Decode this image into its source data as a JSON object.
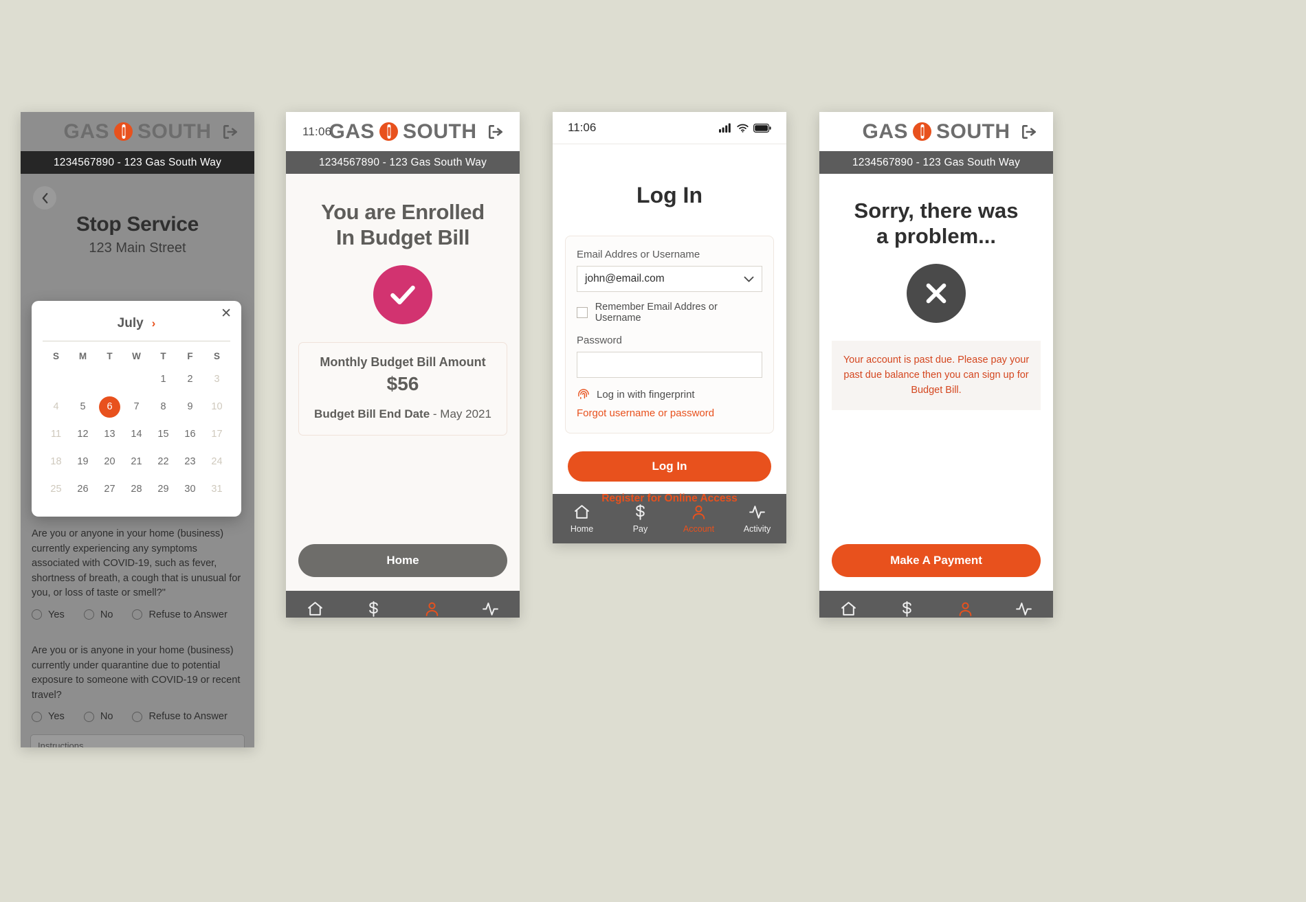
{
  "brand": {
    "name_left": "GAS",
    "name_right": "SOUTH",
    "flame_color": "#e8511d"
  },
  "account_bar": {
    "text": "1234567890 - 123 Gas South Way"
  },
  "tabs": [
    {
      "label": "Home",
      "icon": "home-icon"
    },
    {
      "label": "Pay",
      "icon": "dollar-icon"
    },
    {
      "label": "Account",
      "icon": "person-icon"
    },
    {
      "label": "Activity",
      "icon": "activity-icon"
    }
  ],
  "phone1": {
    "back_icon": "chevron-left-icon",
    "title": "Stop Service",
    "subtitle": "123 Main Street",
    "calendar": {
      "close_icon": "close-icon",
      "month": "July",
      "next_icon": "chevron-right-icon",
      "dow": [
        "S",
        "M",
        "T",
        "W",
        "T",
        "F",
        "S"
      ],
      "weeks": [
        [
          {
            "d": "",
            "state": "empty"
          },
          {
            "d": "",
            "state": "empty"
          },
          {
            "d": "",
            "state": "empty"
          },
          {
            "d": "",
            "state": "empty"
          },
          {
            "d": "1",
            "state": "normal"
          },
          {
            "d": "2",
            "state": "normal"
          },
          {
            "d": "3",
            "state": "muted"
          }
        ],
        [
          {
            "d": "4",
            "state": "muted"
          },
          {
            "d": "5",
            "state": "normal"
          },
          {
            "d": "6",
            "state": "selected"
          },
          {
            "d": "7",
            "state": "normal"
          },
          {
            "d": "8",
            "state": "normal"
          },
          {
            "d": "9",
            "state": "normal"
          },
          {
            "d": "10",
            "state": "muted"
          }
        ],
        [
          {
            "d": "11",
            "state": "muted"
          },
          {
            "d": "12",
            "state": "normal"
          },
          {
            "d": "13",
            "state": "normal"
          },
          {
            "d": "14",
            "state": "normal"
          },
          {
            "d": "15",
            "state": "normal"
          },
          {
            "d": "16",
            "state": "normal"
          },
          {
            "d": "17",
            "state": "muted"
          }
        ],
        [
          {
            "d": "18",
            "state": "muted"
          },
          {
            "d": "19",
            "state": "normal"
          },
          {
            "d": "20",
            "state": "normal"
          },
          {
            "d": "21",
            "state": "normal"
          },
          {
            "d": "22",
            "state": "normal"
          },
          {
            "d": "23",
            "state": "normal"
          },
          {
            "d": "24",
            "state": "muted"
          }
        ],
        [
          {
            "d": "25",
            "state": "muted"
          },
          {
            "d": "26",
            "state": "normal"
          },
          {
            "d": "27",
            "state": "normal"
          },
          {
            "d": "28",
            "state": "normal"
          },
          {
            "d": "29",
            "state": "normal"
          },
          {
            "d": "30",
            "state": "normal"
          },
          {
            "d": "31",
            "state": "muted"
          }
        ]
      ]
    },
    "radio_options": [
      "Yes",
      "No",
      "Refuse to Answer"
    ],
    "question_1": "Are you or anyone in your home (business) currently experiencing any symptoms associated with COVID-19, such as fever, shortness of breath, a cough that is unusual for you, or loss of taste or smell?\"",
    "question_2": "Are you or is anyone in your home (business) currently under quarantine due to potential exposure to someone with COVID-19 or recent travel?",
    "instructions_label": "Instructions"
  },
  "phone2": {
    "clock": "11:06",
    "title_line_1": "You are Enrolled",
    "title_line_2": "In Budget Bill",
    "success_icon": "check-icon",
    "card": {
      "amount_label": "Monthly Budget Bill Amount",
      "amount_value": "$56",
      "end_date_label": "Budget Bill End Date",
      "end_date_value": "- May 2021"
    },
    "home_button": "Home"
  },
  "phone3": {
    "clock": "11:06",
    "signal_icon": "cellular-icon",
    "wifi_icon": "wifi-icon",
    "battery_icon": "battery-icon",
    "title": "Log In",
    "email_label": "Email Addres or Username",
    "email_value": "john@email.com",
    "email_chevron_icon": "chevron-down-icon",
    "remember_label": "Remember Email Addres or Username",
    "password_label": "Password",
    "password_value": "",
    "fingerprint_icon": "fingerprint-icon",
    "fingerprint_label": "Log in with fingerprint",
    "forgot_link": "Forgot username or password",
    "login_button": "Log In",
    "register_link": "Register for Online Access"
  },
  "phone4": {
    "title_line_1": "Sorry, there was",
    "title_line_2": "a problem...",
    "error_icon": "x-icon",
    "error_message": "Your account is past due. Please pay your past due balance then you can sign up for Budget Bill.",
    "pay_button": "Make A Payment"
  },
  "colors": {
    "accent_orange": "#e8511d",
    "success_pink": "#d23370",
    "dark_gray": "#4a4a4a",
    "bar_gray": "#5c5c5c",
    "page_bg": "#ddddd1"
  }
}
